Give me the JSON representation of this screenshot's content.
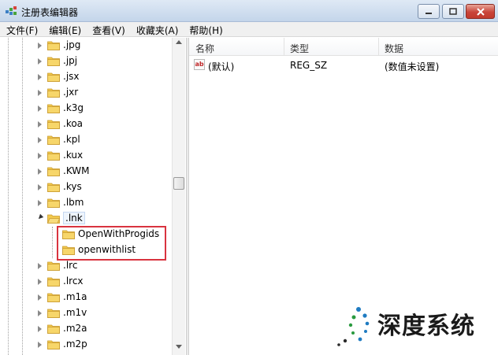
{
  "window": {
    "title": "注册表编辑器",
    "min_glyph": "—",
    "max_glyph": "□",
    "close_glyph": "✕"
  },
  "menu": [
    "文件(F)",
    "编辑(E)",
    "查看(V)",
    "收藏夹(A)",
    "帮助(H)"
  ],
  "tree": {
    "nodes_before": [
      ".jpg",
      ".jpj",
      ".jsx",
      ".jxr",
      ".k3g",
      ".koa",
      ".kpl",
      ".kux",
      ".KWM",
      ".kys",
      ".lbm"
    ],
    "expanded_node": ".lnk",
    "children": [
      "OpenWithProgids",
      "openwithlist"
    ],
    "nodes_after": [
      ".lrc",
      ".lrcx",
      ".m1a",
      ".m1v",
      ".m2a",
      ".m2p"
    ]
  },
  "list": {
    "columns": [
      "名称",
      "类型",
      "数据"
    ],
    "rows": [
      {
        "name": "(默认)",
        "type": "REG_SZ",
        "data": "(数值未设置)",
        "icon": "string-value-icon"
      }
    ],
    "icon_text": "ab"
  },
  "watermark": {
    "text": "深度系统"
  },
  "colors": {
    "highlight": "#d9333f",
    "folder": "#f2c94c",
    "titlebar": "#dfe9f5"
  }
}
